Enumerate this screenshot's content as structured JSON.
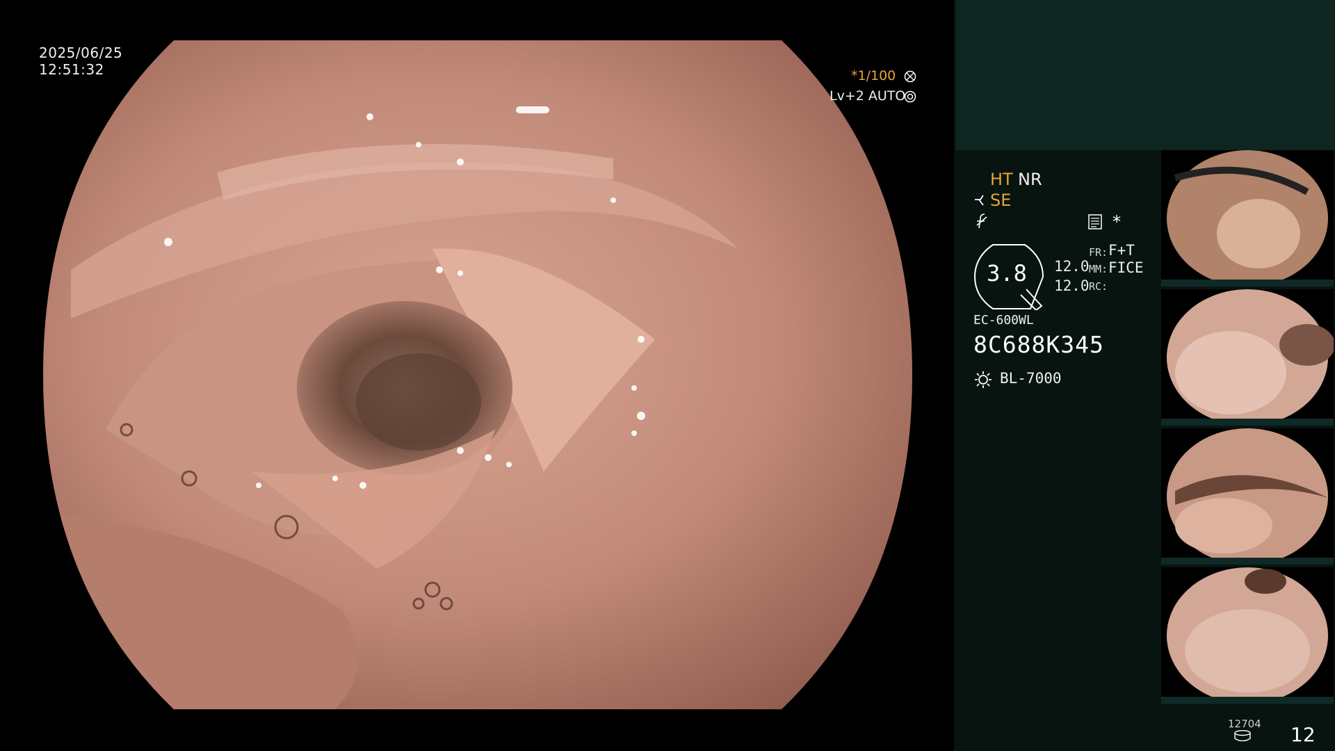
{
  "overlay": {
    "date": "2025/06/25",
    "time": "12:51:32",
    "shutter": "*1/100",
    "level": "Lv+2 AUTO"
  },
  "panel": {
    "ht": "HT",
    "nr": "NR",
    "se": "SE",
    "star": "*",
    "zoom": "3.8",
    "value_a": "12.0",
    "value_b": "12.0",
    "fr_key": "FR:",
    "fr_val": "F+T",
    "mm_key": "MM:",
    "mm_val": "FICE",
    "rc_key": "RC:",
    "model": "EC-600WL",
    "serial": "8C688K345",
    "light": "BL-7000"
  },
  "footer": {
    "count": "12704",
    "page": "12"
  },
  "colors": {
    "accent_orange": "#e8a33a",
    "panel_bg": "#081410",
    "panel_top": "#0e2521",
    "tissue": "#c0897a"
  },
  "icons": [
    "shutter-icon",
    "auto-icon",
    "se-icon",
    "f-icon",
    "memo-icon",
    "light-icon",
    "disk-icon"
  ],
  "thumbnails": [
    {
      "label": "thumbnail-1"
    },
    {
      "label": "thumbnail-2"
    },
    {
      "label": "thumbnail-3"
    },
    {
      "label": "thumbnail-4"
    }
  ]
}
